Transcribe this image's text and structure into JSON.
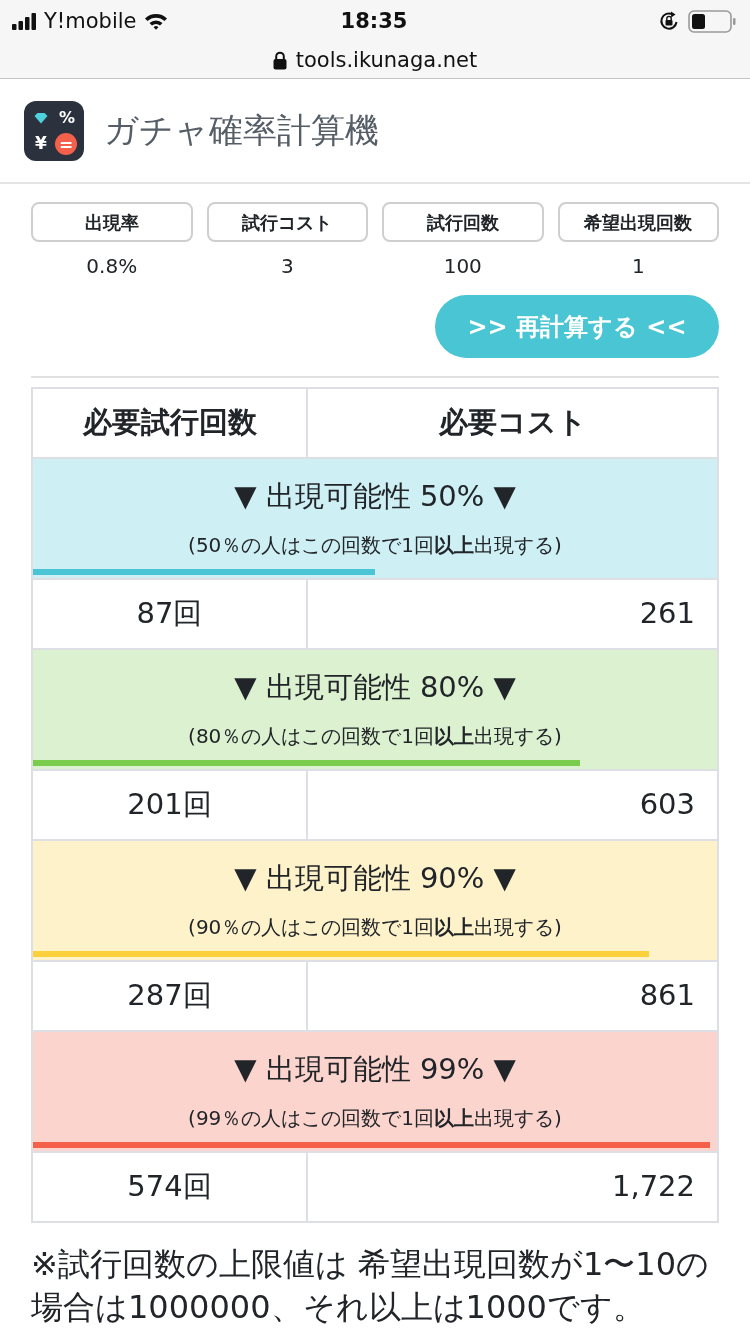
{
  "status_bar": {
    "carrier": "Y!mobile",
    "time": "18:35"
  },
  "browser": {
    "url": "tools.ikunaga.net"
  },
  "header": {
    "logo_symbols": [
      "%",
      "¥",
      "="
    ],
    "title": "ガチャ確率計算機"
  },
  "inputs": [
    {
      "label": "出現率",
      "value": "0.8%"
    },
    {
      "label": "試行コスト",
      "value": "3"
    },
    {
      "label": "試行回数",
      "value": "100"
    },
    {
      "label": "希望出現回数",
      "value": "1"
    }
  ],
  "recalc_button": {
    "label": ">> 再計算する <<"
  },
  "results_table": {
    "columns": [
      "必要試行回数",
      "必要コスト"
    ],
    "sections": [
      {
        "title": "▼ 出現可能性 50% ▼",
        "description": "(50％の人はこの回数で1回**以上**出現する)",
        "level": 0.5,
        "color": "#4bc4d3",
        "trials": "87回",
        "cost": "261"
      },
      {
        "title": "▼ 出現可能性 80% ▼",
        "description": "(80％の人はこの回数で1回**以上**出現する)",
        "level": 0.8,
        "color": "#7acc4c",
        "trials": "201回",
        "cost": "603"
      },
      {
        "title": "▼ 出現可能性 90% ▼",
        "description": "(90％の人はこの回数で1回**以上**出現する)",
        "level": 0.9,
        "color": "#fcd03a",
        "trials": "287回",
        "cost": "861"
      },
      {
        "title": "▼ 出現可能性 99% ▼",
        "description": "(99％の人はこの回数で1回**以上**出現する)",
        "level": 0.99,
        "color": "#f4604a",
        "trials": "574回",
        "cost": "1,722"
      }
    ]
  },
  "note": "※試行回数の上限値は 希望出現回数が1〜10の場合は1000000、それ以上は1000です。"
}
